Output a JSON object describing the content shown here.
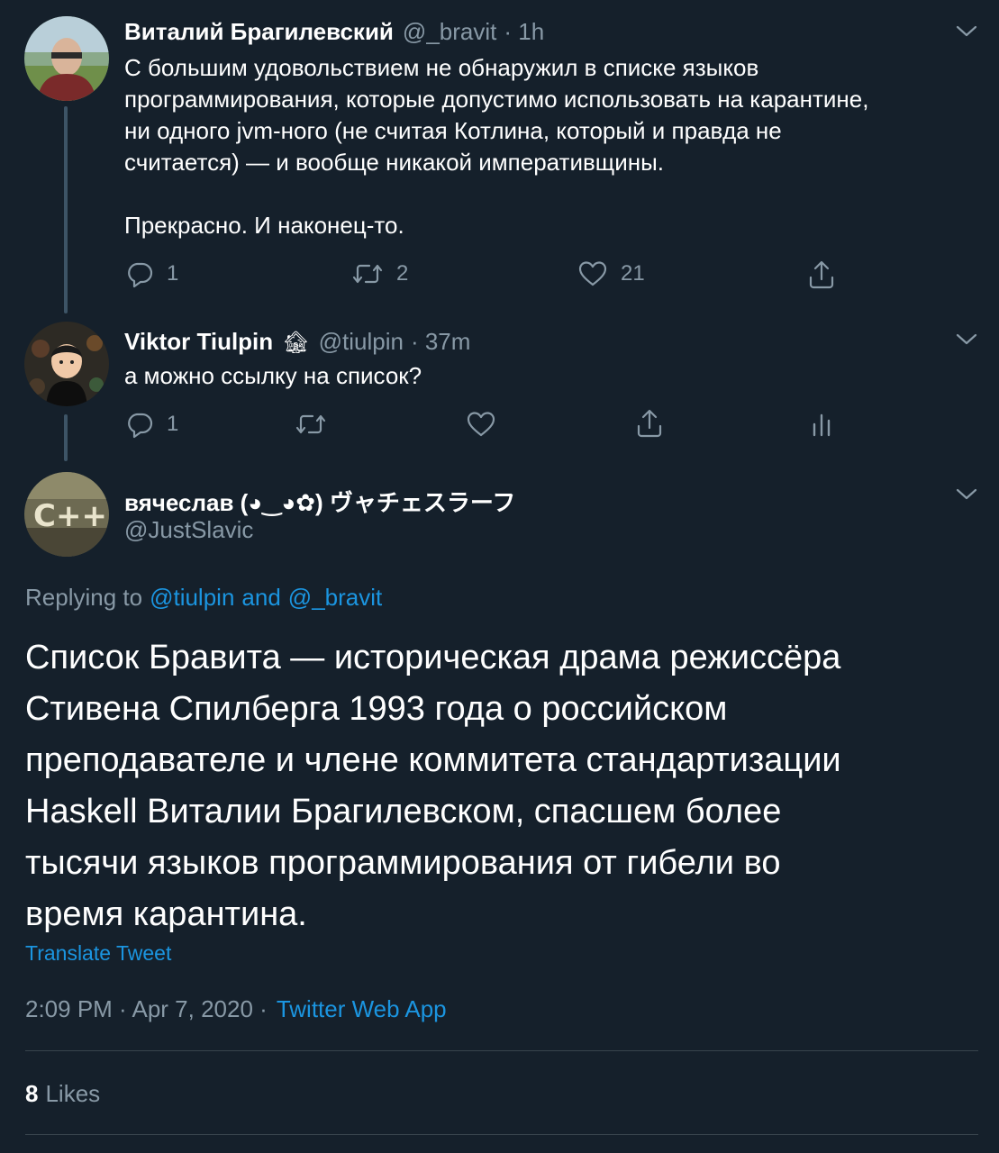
{
  "colors": {
    "background": "#15202b",
    "text": "#ffffff",
    "muted": "#8899a6",
    "link": "#1b95e0",
    "divider": "#38444d"
  },
  "tweet1": {
    "name": "Виталий Брагилевский",
    "handle": "@_bravit",
    "time": "· 1h",
    "text": "С большим удовольствием не обнаружил в списке языков\nпрограммирования, которые допустимо использовать на карантине,\nни одного jvm-ного (не считая Котлина, который и правда не\nсчитается) — и вообще никакой императивщины.\n\nПрекрасно. И наконец-то.",
    "replies": "1",
    "retweets": "2",
    "likes": "21",
    "icons": [
      "reply-icon",
      "retweet-icon",
      "like-icon",
      "share-icon"
    ]
  },
  "tweet2": {
    "name": "Viktor Tiulpin",
    "name_emoji": "🏚",
    "handle": "@tiulpin",
    "time": "· 37m",
    "text": "а можно ссылку на список?",
    "replies": "1",
    "icons": [
      "reply-icon",
      "retweet-icon",
      "like-icon",
      "share-icon",
      "analytics-icon"
    ]
  },
  "main_tweet": {
    "name": "вячеслав (◕‿◕✿) ヴャチェスラーフ",
    "handle": "@JustSlavic",
    "replying_prefix": "Replying to",
    "replying_user1": "@tiulpin",
    "replying_and": "and",
    "replying_user2": "@_bravit",
    "text": "Список Бравита — историческая драма режиссёра\nСтивена Спилберга 1993 года о российском\nпреподавателе и члене коммитета стандартизации\nHaskell Виталии Брагилевском, спасшем более\nтысячи языков программирования от гибели во\nвремя карантина.",
    "translate": "Translate Tweet",
    "timestamp": "2:09 PM · Apr 7, 2020 ·",
    "source": "Twitter Web App",
    "likes_count": "8",
    "likes_label": "Likes"
  }
}
